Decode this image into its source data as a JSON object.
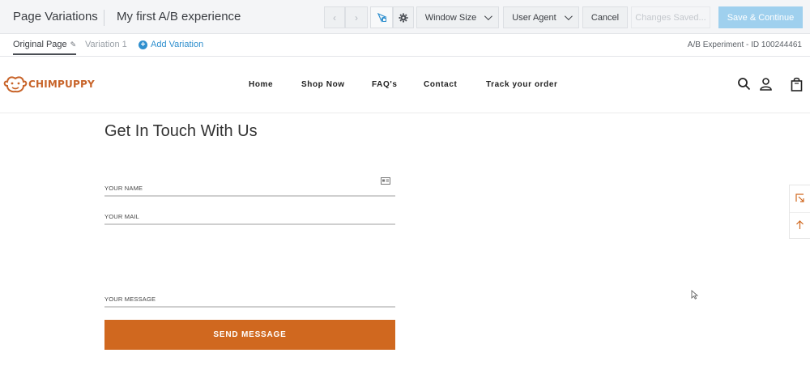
{
  "toolbar": {
    "title": "Page Variations",
    "experience_name": "My first A/B experience",
    "back_arrow": "‹",
    "forward_arrow": "›",
    "select_icon": "cursor-select-icon",
    "settings_icon": "gear-icon",
    "window_size_label": "Window Size",
    "user_agent_label": "User Agent",
    "cancel_label": "Cancel",
    "changes_saved_label": "Changes Saved...",
    "save_continue_label": "Save & Continue",
    "primary_color": "#9fd0ee"
  },
  "tabs": {
    "original_label": "Original Page",
    "variation_label": "Variation 1",
    "add_label": "Add Variation",
    "experiment_id": "A/B Experiment - ID 100244461"
  },
  "site": {
    "logo_text": "CHIMPUPPY",
    "brand_color": "#c8642a",
    "nav": [
      "Home",
      "Shop Now",
      "FAQ's",
      "Contact",
      "Track your order"
    ],
    "icons": [
      "search-icon",
      "user-icon",
      "shopping-bag-icon"
    ]
  },
  "form": {
    "heading": "Get In Touch With Us",
    "name_label": "YOUR NAME",
    "mail_label": "YOUR MAIL",
    "message_label": "YOUR MESSAGE",
    "submit_label": "SEND MESSAGE",
    "button_color": "#d0681f"
  },
  "side_widget": {
    "icons": [
      "bookmark-corner-icon",
      "arrow-up-icon"
    ]
  }
}
